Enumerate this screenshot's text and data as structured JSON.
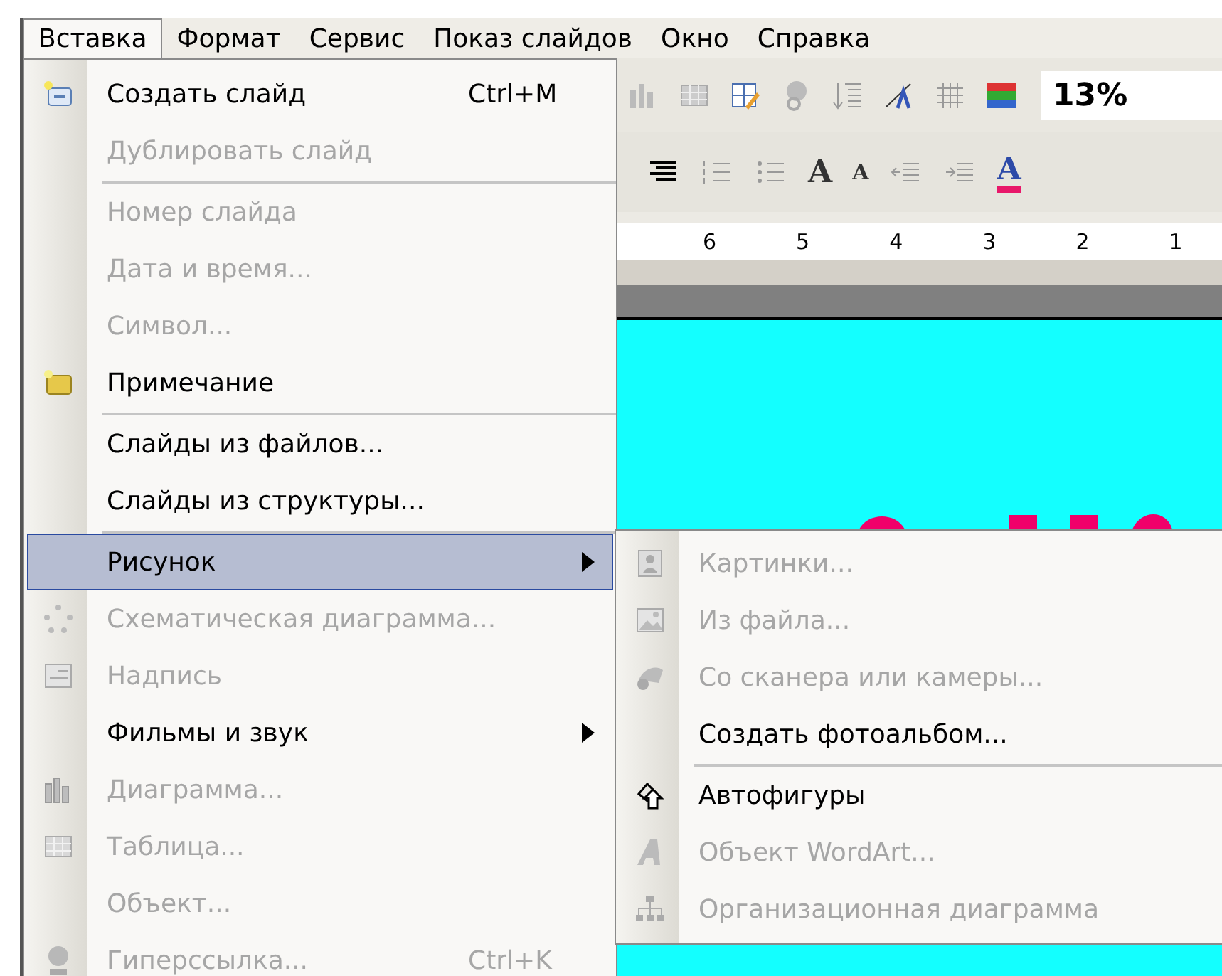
{
  "menu_bar": [
    {
      "label": "Вставка",
      "selected": true
    },
    {
      "label": "Формат",
      "selected": false
    },
    {
      "label": "Сервис",
      "selected": false
    },
    {
      "label": "Показ слайдов",
      "selected": false
    },
    {
      "label": "Окно",
      "selected": false
    },
    {
      "label": "Справка",
      "selected": false
    }
  ],
  "insert_menu": {
    "items": [
      {
        "kind": "item",
        "label": "Создать слайд",
        "shortcut": "Ctrl+M",
        "disabled": false,
        "selected": false
      },
      {
        "kind": "item",
        "label": "Дублировать слайд",
        "disabled": true,
        "selected": false
      },
      {
        "kind": "separator"
      },
      {
        "kind": "item",
        "label": "Номер слайда",
        "disabled": true,
        "selected": false
      },
      {
        "kind": "item",
        "label": "Дата и время...",
        "disabled": true,
        "selected": false
      },
      {
        "kind": "item",
        "label": "Символ...",
        "disabled": true,
        "selected": false
      },
      {
        "kind": "item",
        "label": "Примечание",
        "disabled": false,
        "selected": false
      },
      {
        "kind": "separator"
      },
      {
        "kind": "item",
        "label": "Слайды из файлов...",
        "disabled": false,
        "selected": false
      },
      {
        "kind": "item",
        "label": "Слайды из структуры...",
        "disabled": false,
        "selected": false
      },
      {
        "kind": "separator"
      },
      {
        "kind": "submenu",
        "label": "Рисунок",
        "disabled": false,
        "selected": true
      },
      {
        "kind": "item",
        "label": "Схематическая диаграмма...",
        "disabled": true,
        "selected": false
      },
      {
        "kind": "item",
        "label": "Надпись",
        "disabled": true,
        "selected": false
      },
      {
        "kind": "submenu",
        "label": "Фильмы и звук",
        "disabled": false,
        "selected": false
      },
      {
        "kind": "item",
        "label": "Диаграмма...",
        "disabled": true,
        "selected": false
      },
      {
        "kind": "item",
        "label": "Таблица...",
        "disabled": true,
        "selected": false
      },
      {
        "kind": "item",
        "label": "Объект...",
        "disabled": true,
        "selected": false
      },
      {
        "kind": "item",
        "label": "Гиперссылка...",
        "shortcut": "Ctrl+K",
        "disabled": true,
        "selected": false
      }
    ]
  },
  "picture_submenu": {
    "items": [
      {
        "kind": "item",
        "label": "Картинки...",
        "disabled": true
      },
      {
        "kind": "item",
        "label": "Из файла...",
        "disabled": true
      },
      {
        "kind": "item",
        "label": "Со сканера или камеры...",
        "disabled": true
      },
      {
        "kind": "item",
        "label": "Создать фотоальбом...",
        "disabled": false
      },
      {
        "kind": "separator"
      },
      {
        "kind": "item",
        "label": "Автофигуры",
        "disabled": false
      },
      {
        "kind": "item",
        "label": "Объект WordArt...",
        "disabled": true
      },
      {
        "kind": "item",
        "label": "Организационная диаграмма",
        "disabled": true
      }
    ]
  },
  "toolbar": {
    "zoom": "13%",
    "font_buttons": [
      "A",
      "A",
      "A"
    ]
  },
  "ruler": {
    "labels": [
      "6",
      "5",
      "4",
      "3",
      "2",
      "1"
    ]
  }
}
